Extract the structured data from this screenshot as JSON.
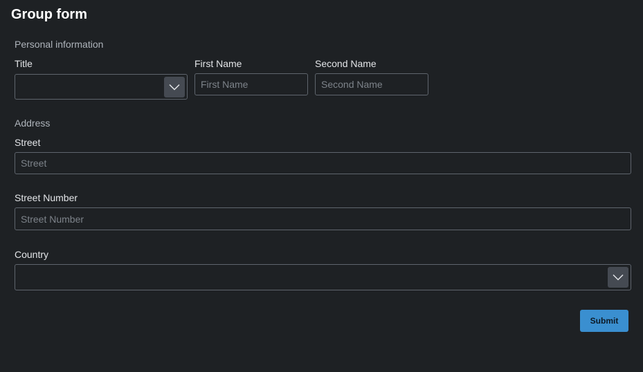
{
  "page": {
    "title": "Group form"
  },
  "personal": {
    "section_label": "Personal information",
    "title_label": "Title",
    "title_value": "",
    "first_name_label": "First Name",
    "first_name_placeholder": "First Name",
    "second_name_label": "Second Name",
    "second_name_placeholder": "Second Name"
  },
  "address": {
    "section_label": "Address",
    "street_label": "Street",
    "street_placeholder": "Street",
    "street_number_label": "Street Number",
    "street_number_placeholder": "Street Number",
    "country_label": "Country",
    "country_value": ""
  },
  "actions": {
    "submit_label": "Submit"
  },
  "icons": {
    "dropdown": "chevron-down-icon"
  },
  "colors": {
    "background": "#1e2124",
    "accent": "#3a8fd0",
    "border": "#5f656d"
  }
}
